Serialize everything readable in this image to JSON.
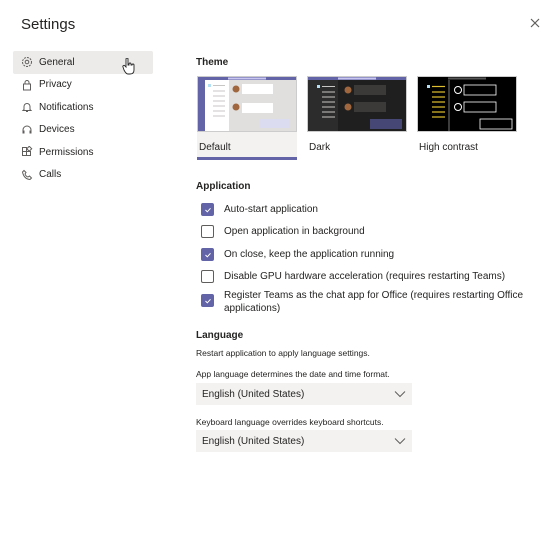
{
  "title": "Settings",
  "sidebar": {
    "items": [
      {
        "label": "General",
        "icon": "gear-icon",
        "active": true
      },
      {
        "label": "Privacy",
        "icon": "lock-icon"
      },
      {
        "label": "Notifications",
        "icon": "bell-icon"
      },
      {
        "label": "Devices",
        "icon": "headset-icon"
      },
      {
        "label": "Permissions",
        "icon": "apps-icon"
      },
      {
        "label": "Calls",
        "icon": "phone-icon"
      }
    ]
  },
  "theme": {
    "heading": "Theme",
    "options": [
      {
        "label": "Default",
        "selected": true
      },
      {
        "label": "Dark"
      },
      {
        "label": "High contrast"
      }
    ]
  },
  "application": {
    "heading": "Application",
    "options": [
      {
        "label": "Auto-start application",
        "checked": true
      },
      {
        "label": "Open application in background",
        "checked": false
      },
      {
        "label": "On close, keep the application running",
        "checked": true
      },
      {
        "label": "Disable GPU hardware acceleration (requires restarting Teams)",
        "checked": false
      },
      {
        "label": "Register Teams as the chat app for Office (requires restarting Office applications)",
        "checked": true
      }
    ]
  },
  "language": {
    "heading": "Language",
    "note": "Restart application to apply language settings.",
    "app_label": "App language determines the date and time format.",
    "app_value": "English (United States)",
    "keyboard_label": "Keyboard language overrides keyboard shortcuts.",
    "keyboard_value": "English (United States)"
  },
  "colors": {
    "accent": "#6264a7",
    "selected_bg": "#edebe9"
  }
}
